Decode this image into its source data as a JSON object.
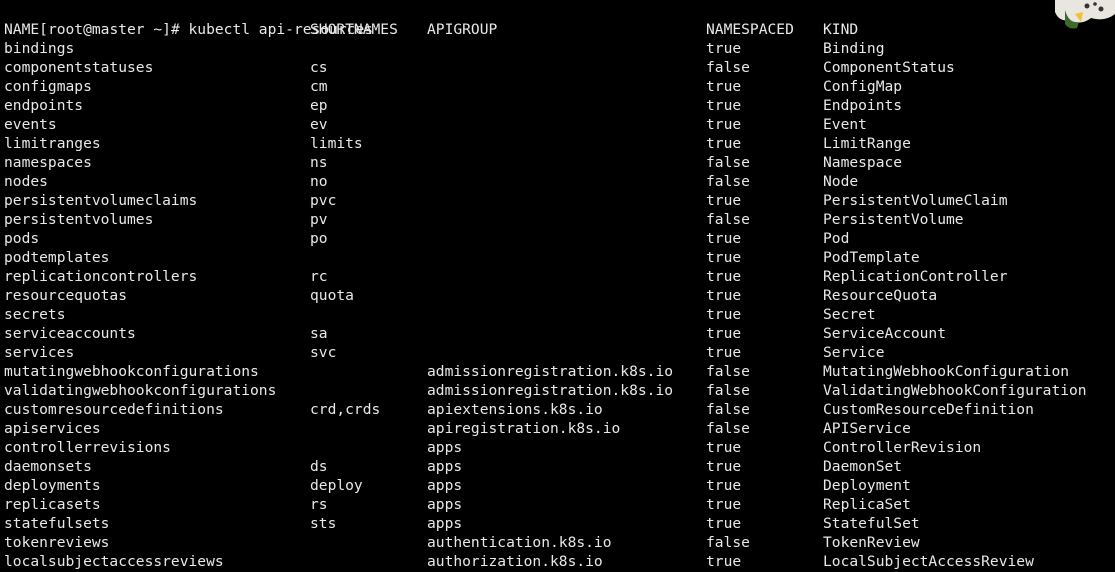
{
  "prompt": "[root@master ~]# kubectl api-resources",
  "headers": {
    "name": "NAME",
    "shortnames": "SHORTNAMES",
    "apigroup": "APIGROUP",
    "namespaced": "NAMESPACED",
    "kind": "KIND"
  },
  "rows": [
    {
      "name": "bindings",
      "short": "",
      "group": "",
      "ns": "true",
      "kind": "Binding"
    },
    {
      "name": "componentstatuses",
      "short": "cs",
      "group": "",
      "ns": "false",
      "kind": "ComponentStatus"
    },
    {
      "name": "configmaps",
      "short": "cm",
      "group": "",
      "ns": "true",
      "kind": "ConfigMap"
    },
    {
      "name": "endpoints",
      "short": "ep",
      "group": "",
      "ns": "true",
      "kind": "Endpoints"
    },
    {
      "name": "events",
      "short": "ev",
      "group": "",
      "ns": "true",
      "kind": "Event"
    },
    {
      "name": "limitranges",
      "short": "limits",
      "group": "",
      "ns": "true",
      "kind": "LimitRange"
    },
    {
      "name": "namespaces",
      "short": "ns",
      "group": "",
      "ns": "false",
      "kind": "Namespace"
    },
    {
      "name": "nodes",
      "short": "no",
      "group": "",
      "ns": "false",
      "kind": "Node"
    },
    {
      "name": "persistentvolumeclaims",
      "short": "pvc",
      "group": "",
      "ns": "true",
      "kind": "PersistentVolumeClaim"
    },
    {
      "name": "persistentvolumes",
      "short": "pv",
      "group": "",
      "ns": "false",
      "kind": "PersistentVolume"
    },
    {
      "name": "pods",
      "short": "po",
      "group": "",
      "ns": "true",
      "kind": "Pod"
    },
    {
      "name": "podtemplates",
      "short": "",
      "group": "",
      "ns": "true",
      "kind": "PodTemplate"
    },
    {
      "name": "replicationcontrollers",
      "short": "rc",
      "group": "",
      "ns": "true",
      "kind": "ReplicationController"
    },
    {
      "name": "resourcequotas",
      "short": "quota",
      "group": "",
      "ns": "true",
      "kind": "ResourceQuota"
    },
    {
      "name": "secrets",
      "short": "",
      "group": "",
      "ns": "true",
      "kind": "Secret"
    },
    {
      "name": "serviceaccounts",
      "short": "sa",
      "group": "",
      "ns": "true",
      "kind": "ServiceAccount"
    },
    {
      "name": "services",
      "short": "svc",
      "group": "",
      "ns": "true",
      "kind": "Service"
    },
    {
      "name": "mutatingwebhookconfigurations",
      "short": "",
      "group": "admissionregistration.k8s.io",
      "ns": "false",
      "kind": "MutatingWebhookConfiguration"
    },
    {
      "name": "validatingwebhookconfigurations",
      "short": "",
      "group": "admissionregistration.k8s.io",
      "ns": "false",
      "kind": "ValidatingWebhookConfiguration"
    },
    {
      "name": "customresourcedefinitions",
      "short": "crd,crds",
      "group": "apiextensions.k8s.io",
      "ns": "false",
      "kind": "CustomResourceDefinition"
    },
    {
      "name": "apiservices",
      "short": "",
      "group": "apiregistration.k8s.io",
      "ns": "false",
      "kind": "APIService"
    },
    {
      "name": "controllerrevisions",
      "short": "",
      "group": "apps",
      "ns": "true",
      "kind": "ControllerRevision"
    },
    {
      "name": "daemonsets",
      "short": "ds",
      "group": "apps",
      "ns": "true",
      "kind": "DaemonSet"
    },
    {
      "name": "deployments",
      "short": "deploy",
      "group": "apps",
      "ns": "true",
      "kind": "Deployment"
    },
    {
      "name": "replicasets",
      "short": "rs",
      "group": "apps",
      "ns": "true",
      "kind": "ReplicaSet"
    },
    {
      "name": "statefulsets",
      "short": "sts",
      "group": "apps",
      "ns": "true",
      "kind": "StatefulSet"
    },
    {
      "name": "tokenreviews",
      "short": "",
      "group": "authentication.k8s.io",
      "ns": "false",
      "kind": "TokenReview"
    },
    {
      "name": "localsubjectaccessreviews",
      "short": "",
      "group": "authorization.k8s.io",
      "ns": "true",
      "kind": "LocalSubjectAccessReview"
    }
  ],
  "colors": {
    "background": "#000000",
    "foreground": "#e8e8e8"
  }
}
